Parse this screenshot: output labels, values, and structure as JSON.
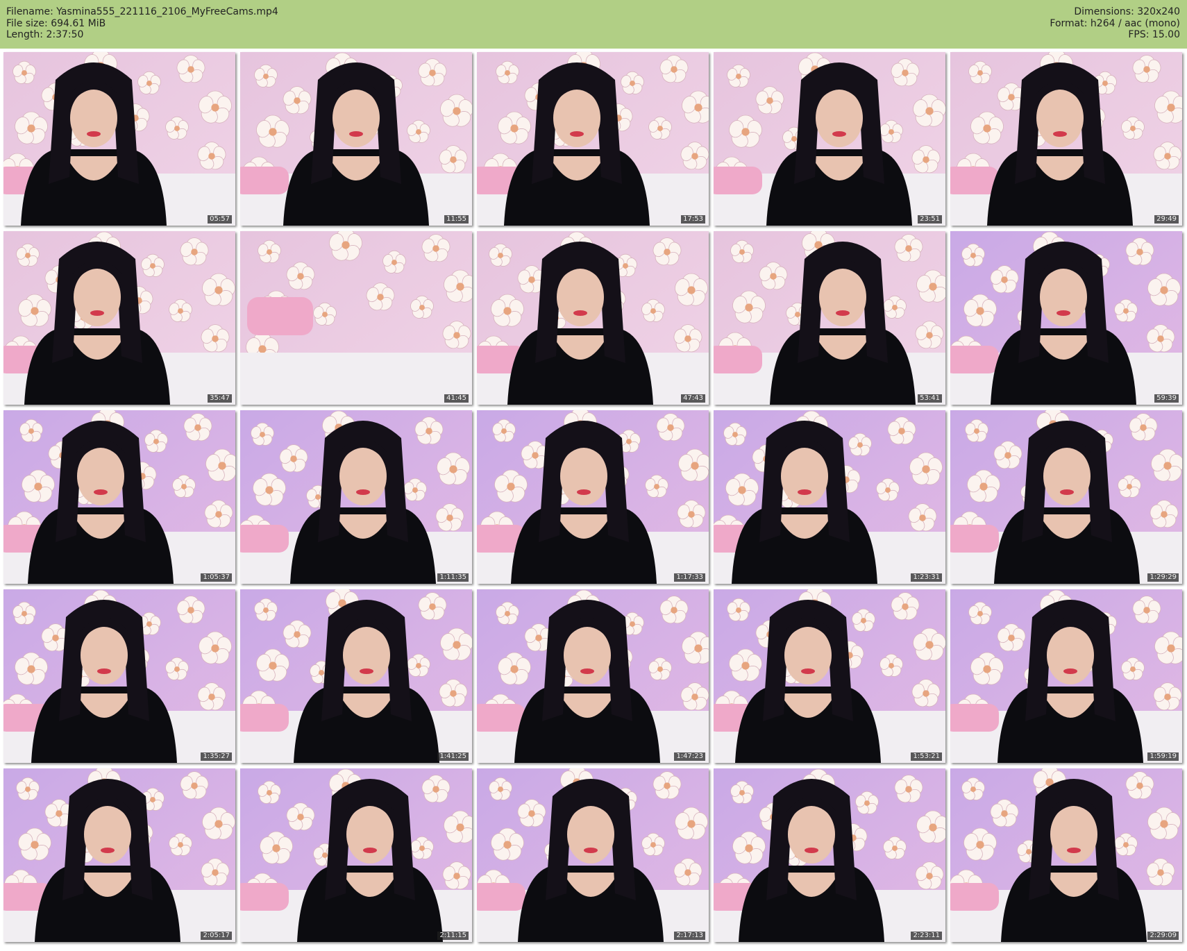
{
  "header": {
    "filename": "Filename: Yasmina555_221116_2106_MyFreeCams.mp4",
    "filesize": "File size: 694.61 MiB",
    "length": "Length: 2:37:50",
    "dimensions": "Dimensions: 320x240",
    "format": "Format: h264 / aac (mono)",
    "fps": "FPS: 15.00"
  },
  "colors": {
    "header_bg": "#b1cf85",
    "wallpaper_pink": "#e6c4de",
    "wallpaper_lilac": "#c9a9e6",
    "hair": "#141018",
    "top": "#0c0c10",
    "skin": "#e8c3b0",
    "bed": "#f1eef2",
    "pillow": "#efa9c9"
  },
  "frames": [
    {
      "time": "05:57"
    },
    {
      "time": "11:55"
    },
    {
      "time": "17:53"
    },
    {
      "time": "23:51"
    },
    {
      "time": "29:49"
    },
    {
      "time": "35:47"
    },
    {
      "time": "41:45"
    },
    {
      "time": "47:43"
    },
    {
      "time": "53:41"
    },
    {
      "time": "59:39"
    },
    {
      "time": "1:05:37"
    },
    {
      "time": "1:11:35"
    },
    {
      "time": "1:17:33"
    },
    {
      "time": "1:23:31"
    },
    {
      "time": "1:29:29"
    },
    {
      "time": "1:35:27"
    },
    {
      "time": "1:41:25"
    },
    {
      "time": "1:47:23"
    },
    {
      "time": "1:53:21"
    },
    {
      "time": "1:59:19"
    },
    {
      "time": "2:05:17"
    },
    {
      "time": "2:11:15"
    },
    {
      "time": "2:17:13"
    },
    {
      "time": "2:23:11"
    },
    {
      "time": "2:29:09"
    }
  ]
}
